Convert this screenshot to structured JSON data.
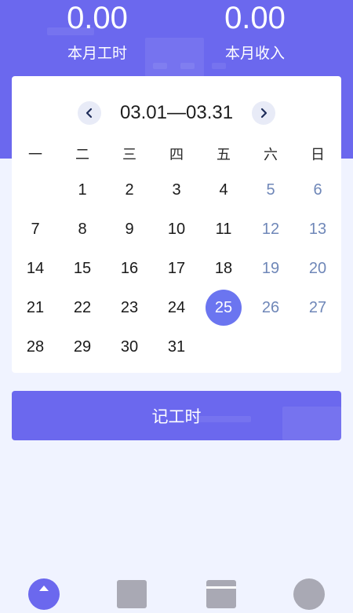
{
  "summary": {
    "hours_value": "0.00",
    "hours_label": "本月工时",
    "income_value": "0.00",
    "income_label": "本月收入"
  },
  "calendar": {
    "range": "03.01—03.31",
    "weekdays": [
      "一",
      "二",
      "三",
      "四",
      "五",
      "六",
      "日"
    ],
    "weeks": [
      [
        "",
        "1",
        "2",
        "3",
        "4",
        "5",
        "6"
      ],
      [
        "7",
        "8",
        "9",
        "10",
        "11",
        "12",
        "13"
      ],
      [
        "14",
        "15",
        "16",
        "17",
        "18",
        "19",
        "20"
      ],
      [
        "21",
        "22",
        "23",
        "24",
        "25",
        "26",
        "27"
      ],
      [
        "28",
        "29",
        "30",
        "31",
        "",
        "",
        ""
      ]
    ],
    "selected_day": "25"
  },
  "action": {
    "log_hours_label": "记工时"
  },
  "tabbar": {
    "icons": [
      "home-icon",
      "stats-icon",
      "calendar-icon",
      "profile-icon"
    ]
  },
  "colors": {
    "accent": "#6b68ee",
    "selected": "#6b75f0",
    "weekend": "#6f87b8",
    "background": "#f0f3ff"
  }
}
